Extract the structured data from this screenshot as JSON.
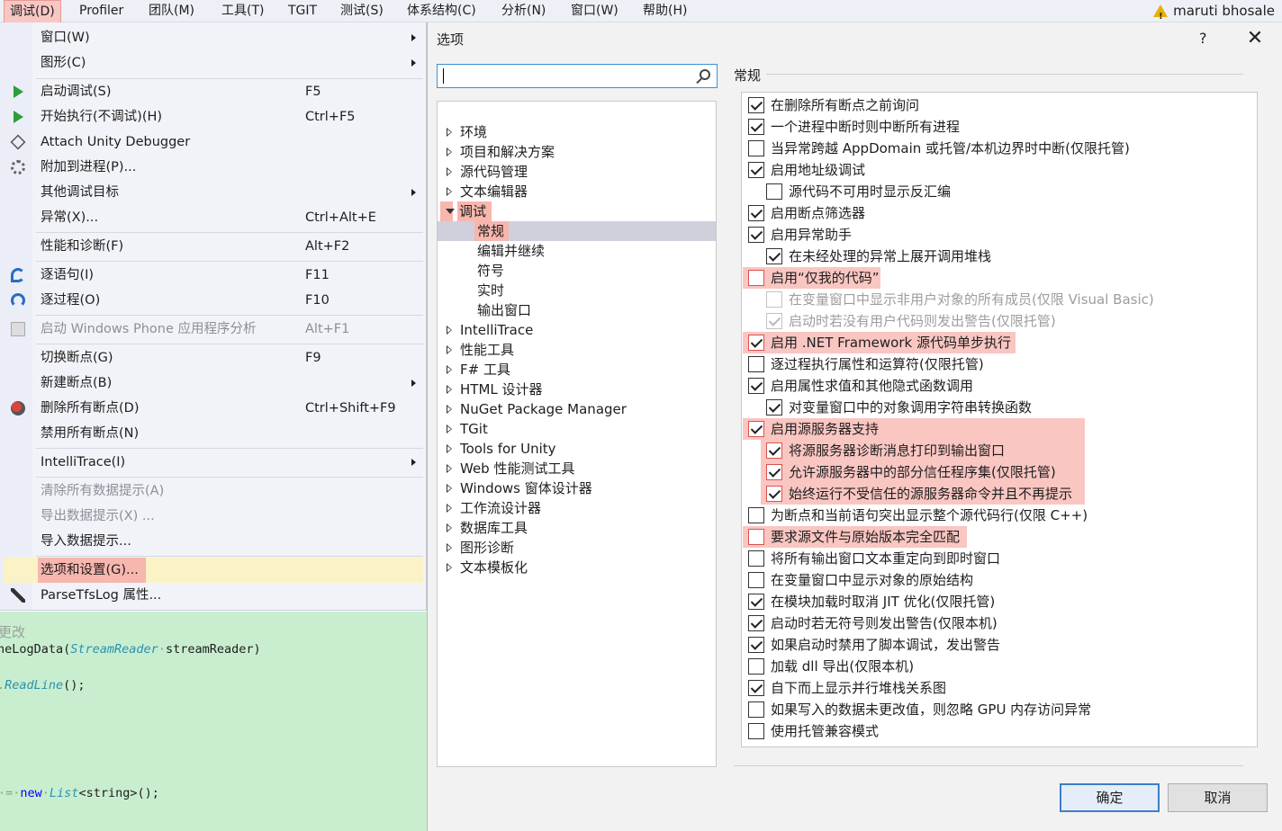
{
  "menubar": {
    "items": [
      "调试(D)",
      "Profiler",
      "团队(M)",
      "工具(T)",
      "TGIT",
      "测试(S)",
      "体系结构(C)",
      "分析(N)",
      "窗口(W)",
      "帮助(H)"
    ],
    "user": "maruti bhosale"
  },
  "debug_menu": {
    "items": [
      {
        "label": "窗口(W)",
        "shortcut": "",
        "submenu": true
      },
      {
        "label": "图形(C)",
        "shortcut": "",
        "submenu": true
      },
      {
        "label": "启动调试(S)",
        "shortcut": "F5",
        "icon": "play-icon"
      },
      {
        "label": "开始执行(不调试)(H)",
        "shortcut": "Ctrl+F5",
        "icon": "play-outline-icon"
      },
      {
        "label": "Attach Unity Debugger",
        "shortcut": "",
        "icon": "unity-cube-icon"
      },
      {
        "label": "附加到进程(P)...",
        "shortcut": "",
        "icon": "gears-icon"
      },
      {
        "label": "其他调试目标",
        "shortcut": "",
        "submenu": true
      },
      {
        "label": "异常(X)...",
        "shortcut": "Ctrl+Alt+E"
      },
      {
        "label": "性能和诊断(F)",
        "shortcut": "Alt+F2"
      },
      {
        "label": "逐语句(I)",
        "shortcut": "F11",
        "icon": "step-into-icon"
      },
      {
        "label": "逐过程(O)",
        "shortcut": "F10",
        "icon": "step-over-icon"
      },
      {
        "label": "启动 Windows Phone 应用程序分析",
        "shortcut": "Alt+F1",
        "disabled": true,
        "icon": "phone-icon"
      },
      {
        "label": "切换断点(G)",
        "shortcut": "F9"
      },
      {
        "label": "新建断点(B)",
        "shortcut": "",
        "submenu": true
      },
      {
        "label": "删除所有断点(D)",
        "shortcut": "Ctrl+Shift+F9",
        "icon": "delete-breakpoints-icon"
      },
      {
        "label": "禁用所有断点(N)",
        "shortcut": ""
      },
      {
        "label": "IntelliTrace(I)",
        "shortcut": "",
        "submenu": true
      },
      {
        "label": "清除所有数据提示(A)",
        "shortcut": "",
        "disabled": true
      },
      {
        "label": "导出数据提示(X) ...",
        "shortcut": "",
        "disabled": true
      },
      {
        "label": "导入数据提示...",
        "shortcut": ""
      },
      {
        "label": "选项和设置(G)...",
        "shortcut": "",
        "highlighted": true
      },
      {
        "label": "ParseTfsLog 属性...",
        "shortcut": "",
        "icon": "wrench-icon"
      }
    ]
  },
  "editor": {
    "line1": "更改",
    "line2_prefix": "neLogData(",
    "line2_type": "StreamReader",
    "line2_suffix": "streamReader)",
    "line3_method": "ReadLine",
    "line3_suffix": "();",
    "line4_kw": "new",
    "line4_type": "List",
    "line4_generic": "<string>",
    "line4_suffix": "();"
  },
  "dialog": {
    "title": "选项",
    "help": "?",
    "search_placeholder": "",
    "tree": [
      {
        "label": "环境",
        "level": 0
      },
      {
        "label": "项目和解决方案",
        "level": 0
      },
      {
        "label": "源代码管理",
        "level": 0
      },
      {
        "label": "文本编辑器",
        "level": 0
      },
      {
        "label": "调试",
        "level": 0,
        "expanded": true
      },
      {
        "label": "常规",
        "level": 1,
        "selected": true
      },
      {
        "label": "编辑并继续",
        "level": 1
      },
      {
        "label": "符号",
        "level": 1
      },
      {
        "label": "实时",
        "level": 1
      },
      {
        "label": "输出窗口",
        "level": 1
      },
      {
        "label": "IntelliTrace",
        "level": 0
      },
      {
        "label": "性能工具",
        "level": 0
      },
      {
        "label": "F# 工具",
        "level": 0
      },
      {
        "label": "HTML 设计器",
        "level": 0
      },
      {
        "label": "NuGet Package Manager",
        "level": 0
      },
      {
        "label": "TGit",
        "level": 0
      },
      {
        "label": "Tools for Unity",
        "level": 0
      },
      {
        "label": "Web 性能测试工具",
        "level": 0
      },
      {
        "label": "Windows 窗体设计器",
        "level": 0
      },
      {
        "label": "工作流设计器",
        "level": 0
      },
      {
        "label": "数据库工具",
        "level": 0
      },
      {
        "label": "图形诊断",
        "level": 0
      },
      {
        "label": "文本模板化",
        "level": 0
      }
    ],
    "section_title": "常规",
    "options": [
      {
        "label": "在删除所有断点之前询问",
        "checked": true,
        "indent": 0
      },
      {
        "label": "一个进程中断时则中断所有进程",
        "checked": true,
        "indent": 0
      },
      {
        "label": "当异常跨越 AppDomain 或托管/本机边界时中断(仅限托管)",
        "checked": false,
        "indent": 0
      },
      {
        "label": "启用地址级调试",
        "checked": true,
        "indent": 0
      },
      {
        "label": "源代码不可用时显示反汇编",
        "checked": false,
        "indent": 1
      },
      {
        "label": "启用断点筛选器",
        "checked": true,
        "indent": 0
      },
      {
        "label": "启用异常助手",
        "checked": true,
        "indent": 0
      },
      {
        "label": "在未经处理的异常上展开调用堆栈",
        "checked": true,
        "indent": 1
      },
      {
        "label": "启用“仅我的代码”",
        "checked": false,
        "indent": 0,
        "highlight": true
      },
      {
        "label": "在变量窗口中显示非用户对象的所有成员(仅限 Visual Basic)",
        "checked": false,
        "indent": 1,
        "disabled": true
      },
      {
        "label": "启动时若没有用户代码则发出警告(仅限托管)",
        "checked": true,
        "indent": 1,
        "disabled": true
      },
      {
        "label": "启用 .NET Framework 源代码单步执行",
        "checked": true,
        "indent": 0,
        "highlight": true
      },
      {
        "label": "逐过程执行属性和运算符(仅限托管)",
        "checked": false,
        "indent": 0
      },
      {
        "label": "启用属性求值和其他隐式函数调用",
        "checked": true,
        "indent": 0
      },
      {
        "label": "对变量窗口中的对象调用字符串转换函数",
        "checked": true,
        "indent": 1
      },
      {
        "label": "启用源服务器支持",
        "checked": true,
        "indent": 0,
        "highlight": true
      },
      {
        "label": "将源服务器诊断消息打印到输出窗口",
        "checked": true,
        "indent": 1,
        "highlight": true
      },
      {
        "label": "允许源服务器中的部分信任程序集(仅限托管)",
        "checked": true,
        "indent": 1,
        "highlight": true
      },
      {
        "label": "始终运行不受信任的源服务器命令并且不再提示",
        "checked": true,
        "indent": 1,
        "highlight": true
      },
      {
        "label": "为断点和当前语句突出显示整个源代码行(仅限 C++)",
        "checked": false,
        "indent": 0
      },
      {
        "label": "要求源文件与原始版本完全匹配",
        "checked": false,
        "indent": 0,
        "highlight": true
      },
      {
        "label": "将所有输出窗口文本重定向到即时窗口",
        "checked": false,
        "indent": 0
      },
      {
        "label": "在变量窗口中显示对象的原始结构",
        "checked": false,
        "indent": 0
      },
      {
        "label": "在模块加载时取消 JIT 优化(仅限托管)",
        "checked": true,
        "indent": 0
      },
      {
        "label": "启动时若无符号则发出警告(仅限本机)",
        "checked": true,
        "indent": 0
      },
      {
        "label": "如果启动时禁用了脚本调试，发出警告",
        "checked": true,
        "indent": 0
      },
      {
        "label": "加载 dll 导出(仅限本机)",
        "checked": false,
        "indent": 0
      },
      {
        "label": "自下而上显示并行堆栈关系图",
        "checked": true,
        "indent": 0
      },
      {
        "label": "如果写入的数据未更改值，则忽略 GPU 内存访问异常",
        "checked": false,
        "indent": 0
      },
      {
        "label": "使用托管兼容模式",
        "checked": false,
        "indent": 0
      }
    ],
    "ok_label": "确定",
    "cancel_label": "取消"
  }
}
